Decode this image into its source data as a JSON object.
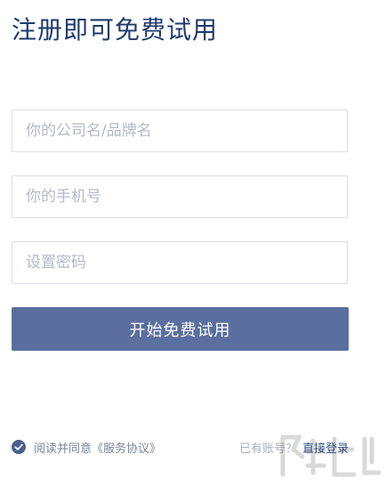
{
  "page": {
    "title": "注册即可免费试用"
  },
  "form": {
    "company_placeholder": "你的公司名/品牌名",
    "phone_placeholder": "你的手机号",
    "password_placeholder": "设置密码",
    "submit_label": "开始免费试用"
  },
  "footer": {
    "agree_text": "阅读并同意",
    "agree_link": "《服务协议》",
    "login_prompt": "已有账号？",
    "login_link": "直接登录"
  },
  "colors": {
    "title": "#1f3b6e",
    "button": "#5a6f9f",
    "check_icon": "#4a5f8e"
  },
  "icons": {
    "agree_check": "check-circle-icon"
  }
}
